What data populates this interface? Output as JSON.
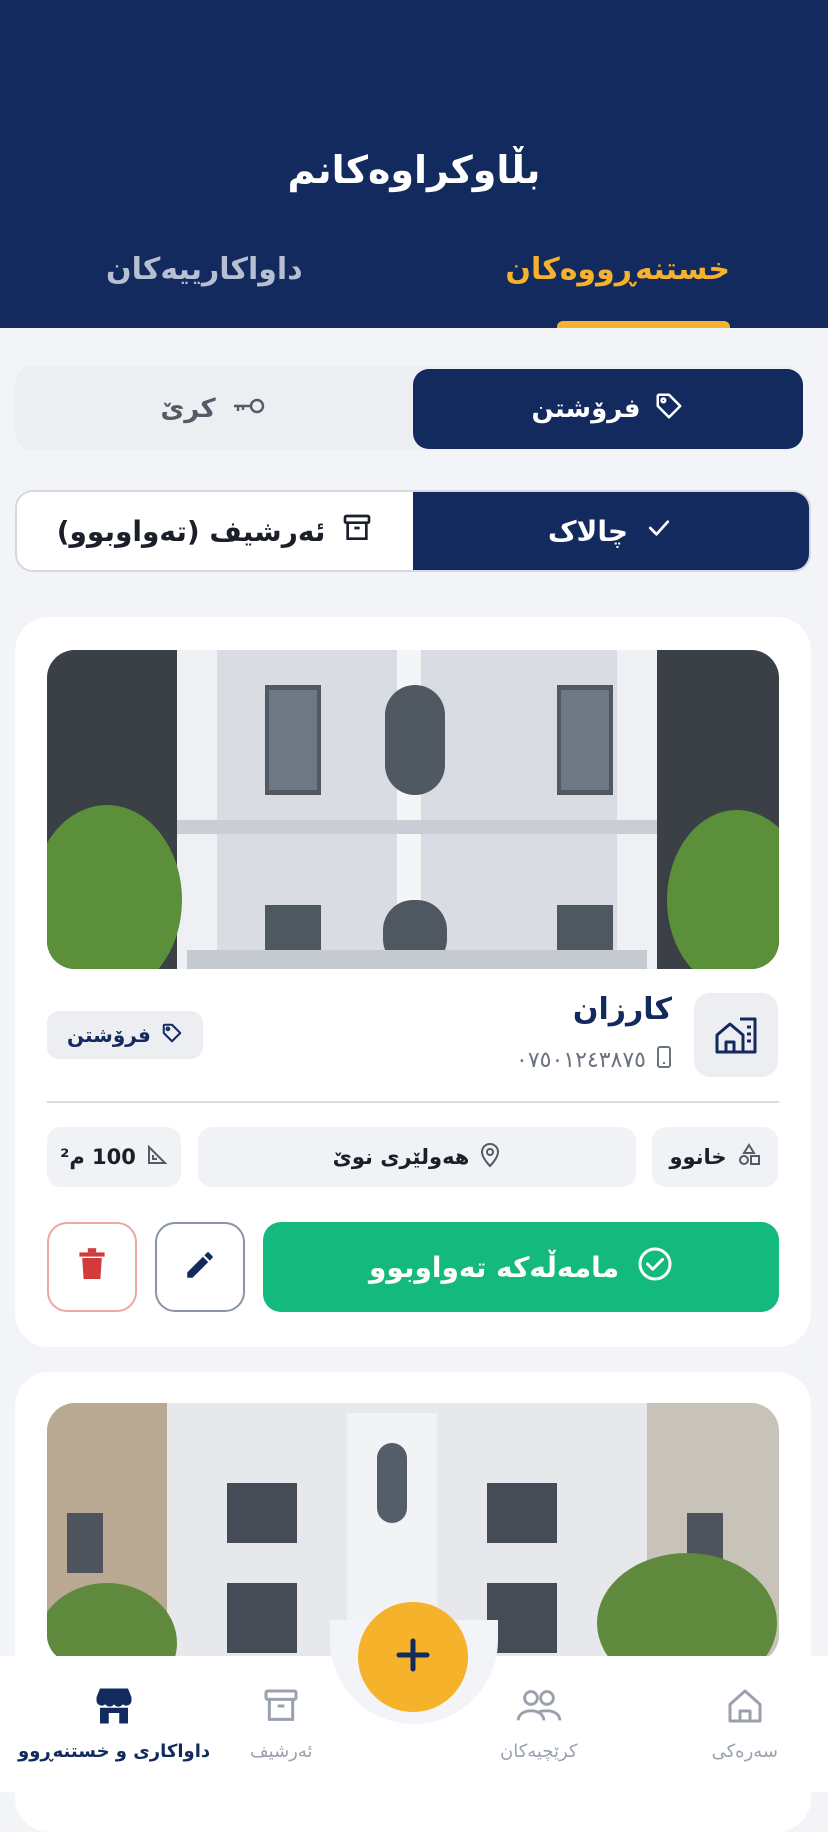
{
  "header": {
    "title": "بڵاوکراوەکانم",
    "tabs": [
      {
        "label": "خستنەڕووەکان",
        "active": true
      },
      {
        "label": "داواکارییەکان",
        "active": false
      }
    ]
  },
  "deal_filter": {
    "sale_label": "فرۆشتن",
    "rent_label": "کرێ"
  },
  "status_filter": {
    "active_label": "چالاک",
    "archive_label": "ئەرشیف (تەواوبوو)"
  },
  "listing": {
    "owner_name": "کارزان",
    "phone": "٠٧٥٠١٢٤٣٨٧٥",
    "deal_type": "فرۆشتن",
    "property_type": "خانوو",
    "location": "هەولێری نوێ",
    "area": "100 م²",
    "complete_button": "مامەڵەکە تەواوبوو"
  },
  "bottom_nav": {
    "items": [
      {
        "label": "سەرەکی",
        "icon": "home-icon"
      },
      {
        "label": "کرێچیەکان",
        "icon": "people-icon"
      },
      {
        "label": "ئەرشیف",
        "icon": "archive-icon"
      },
      {
        "label": "داواکاری و خستنەڕوو",
        "icon": "store-icon"
      }
    ]
  },
  "colors": {
    "primary": "#132a5e",
    "accent": "#f5b22a",
    "success": "#14b97e",
    "danger": "#d13b3b"
  }
}
